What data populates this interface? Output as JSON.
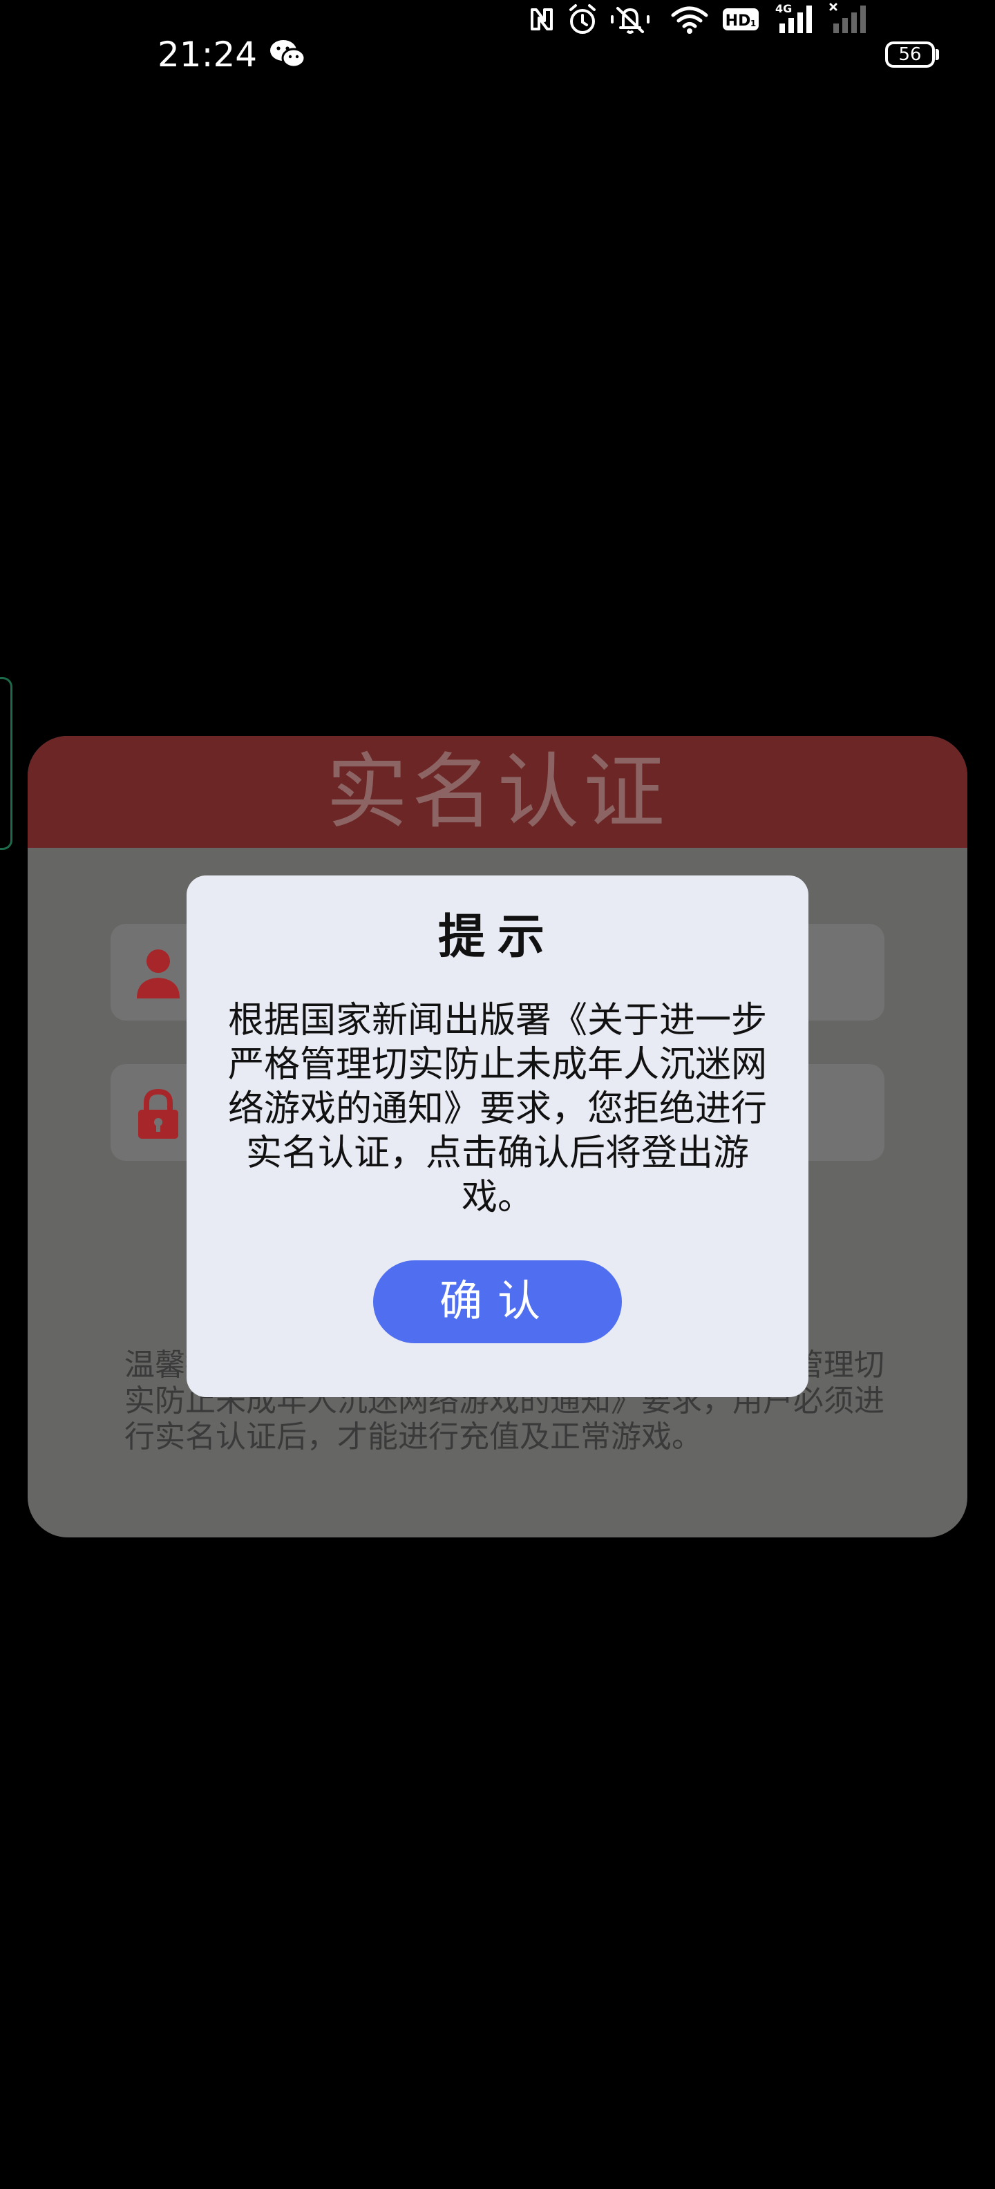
{
  "status_bar": {
    "time": "21:24",
    "battery": "56",
    "icons": [
      "wechat-icon",
      "nfc-icon",
      "alarm-icon",
      "mute-icon",
      "wifi-icon",
      "hd-icon",
      "signal-4g-icon",
      "signal-off-icon"
    ]
  },
  "auth_card": {
    "title": "实名认证",
    "notice_partial": "温馨提示：根据国家新闻出版署《关于进一步严格管理切实防止未成年人沉迷网络游戏的通知》要求，用户必须进行实名认证后，才能进行充值及正常游戏。"
  },
  "dialog": {
    "title": "提示",
    "message": "根据国家新闻出版署《关于进一步严格管理切实防止未成年人沉迷网络游戏的通知》要求，您拒绝进行实名认证，点击确认后将登出游戏。",
    "confirm_label": "确认"
  },
  "colors": {
    "header_red": "#6b2625",
    "icon_red": "#a7262a",
    "confirm_blue": "#4f6ef0",
    "dialog_bg": "#e9ebf4"
  }
}
